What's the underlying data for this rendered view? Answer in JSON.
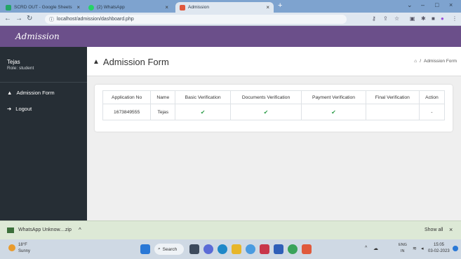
{
  "browser": {
    "tabs": [
      {
        "label": "SCRD OUT - Google Sheets",
        "icon": "sheets-icon",
        "color": "#23a566"
      },
      {
        "label": "(2) WhatsApp",
        "icon": "whatsapp-icon",
        "color": "#25d366"
      },
      {
        "label": "Admission",
        "icon": "admission-favicon",
        "color": "#e0583d"
      }
    ],
    "url": "localhost/admission/dashboard.php"
  },
  "brand": {
    "logo": "Admission",
    "color": "#6b4f8a"
  },
  "sidebar": {
    "user_name": "Tejas",
    "role": "Role: student",
    "items": [
      {
        "label": "Admission Form",
        "icon": "user-icon"
      },
      {
        "label": "Logout",
        "icon": "logout-icon"
      }
    ]
  },
  "page": {
    "title": "Admission Form",
    "breadcrumb_sep": "/",
    "breadcrumb": "Admission Form"
  },
  "table": {
    "headers": [
      "Application No",
      "Name",
      "Basic Verification",
      "Documents Verification",
      "Payment Verification",
      "Final Verification",
      "Action"
    ],
    "row": {
      "app_no": "1673849555",
      "name": "Tejas",
      "basic": "✔",
      "documents": "✔",
      "payment": "✔",
      "final": "",
      "action": "-"
    }
  },
  "download": {
    "file": "WhatsApp Unknow....zip",
    "show_all": "Show all"
  },
  "taskbar": {
    "weather_temp": "18°F",
    "weather_desc": "Sunny",
    "search": "Search",
    "lang": "ENG",
    "region": "IN",
    "time": "15:05",
    "date": "03-02-2023"
  }
}
